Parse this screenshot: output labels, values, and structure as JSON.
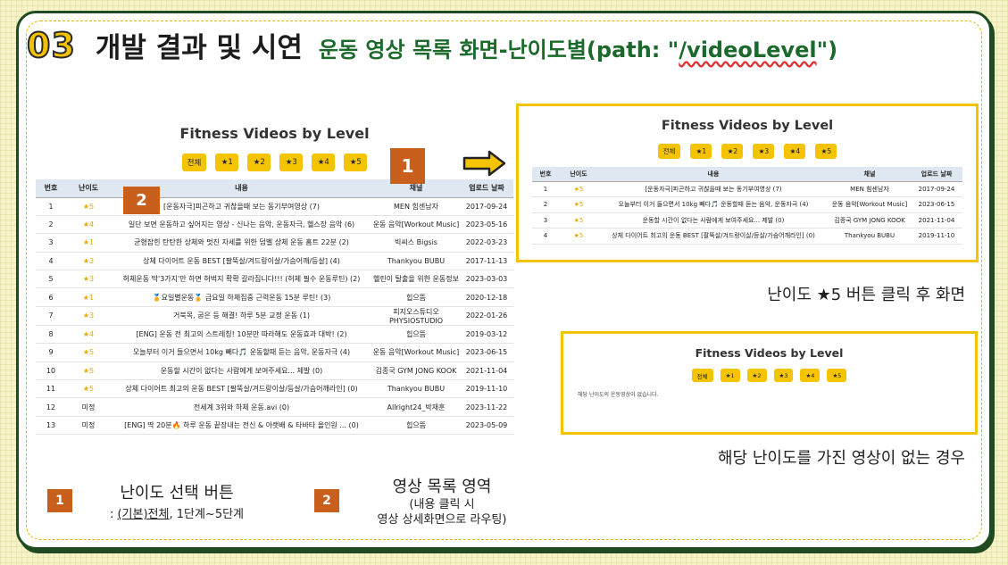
{
  "header": {
    "number": "03",
    "title": "개발 결과 및 시연",
    "subtitle_prefix": "운동 영상 목록 화면-난이도별(path: \"",
    "subtitle_path": "/videoLevel",
    "subtitle_suffix": "\")"
  },
  "main": {
    "title": "Fitness Videos by Level",
    "level_buttons": [
      "전체",
      "★1",
      "★2",
      "★3",
      "★4",
      "★5"
    ],
    "columns": [
      "번호",
      "난이도",
      "내용",
      "채널",
      "업로드 날짜"
    ],
    "rows": [
      {
        "no": "1",
        "level": "★5",
        "title": "[운동자극]피곤하고 귀찮을때 보는 동기부여영상 (7)",
        "channel": "MEN 힘센남자",
        "date": "2017-09-24"
      },
      {
        "no": "2",
        "level": "★4",
        "title": "일단 보면 운동하고 싶어지는 영상 - 신나는 음악, 운동자극, 헬스장 음악 (6)",
        "channel": "운동 음악[Workout Music]",
        "date": "2023-05-16"
      },
      {
        "no": "3",
        "level": "★1",
        "title": "균형잡힌 탄탄한 상체와 멋진 자세를 위한 덤벨 상체 운동 홈트 22분 (2)",
        "channel": "빅씨스 Bigsis",
        "date": "2022-03-23"
      },
      {
        "no": "4",
        "level": "★3",
        "title": "상체 다이어트 운동 BEST [팔뚝살/겨드랑이살/가슴어깨/등살] (4)",
        "channel": "Thankyou BUBU",
        "date": "2017-11-13"
      },
      {
        "no": "5",
        "level": "★3",
        "title": "허체운동 딱'3가지'만 하면 허벅지 확확 갈라집니다!!! (허체 필수 운동루틴) (2)",
        "channel": "헬린이 탈출을 위한 운동정보",
        "date": "2023-03-03"
      },
      {
        "no": "6",
        "level": "★1",
        "title": "🏅요일별운동🏅 금요일 하체집중 근력운동 15분 루틴! (3)",
        "channel": "힙으뜸",
        "date": "2020-12-18"
      },
      {
        "no": "7",
        "level": "★3",
        "title": "거북목, 굽은 등 해결! 하루 5분 교정 운동 (1)",
        "channel": "피지오스튜디오 PHYSIOSTUDIO",
        "date": "2022-01-26"
      },
      {
        "no": "8",
        "level": "★4",
        "title": "[ENG] 운동 전 최고의 스트레칭! 10분만 따라해도 운동효과 대박! (2)",
        "channel": "힙으뜸",
        "date": "2019-03-12"
      },
      {
        "no": "9",
        "level": "★5",
        "title": "오늘부터 이거 들으면서 10kg 빼다🎵 운동할때 듣는 음악, 운동자극 (4)",
        "channel": "운동 음악[Workout Music]",
        "date": "2023-06-15"
      },
      {
        "no": "10",
        "level": "★5",
        "title": "운동할 시간이 없다는 사람에게 보여주세요... 제발 (0)",
        "channel": "김종국 GYM JONG KOOK",
        "date": "2021-11-04"
      },
      {
        "no": "11",
        "level": "★5",
        "title": "상체 다이어트 최고의 운동 BEST [팔뚝살/겨드랑이살/등살/가슴어깨라인] (0)",
        "channel": "Thankyou BUBU",
        "date": "2019-11-10"
      },
      {
        "no": "12",
        "level": "미정",
        "title": "전세계 3위와 하체 운동.avi (0)",
        "channel": "Allright24_박재훈",
        "date": "2023-11-22"
      },
      {
        "no": "13",
        "level": "미정",
        "title": "[ENG] 딱 20분🔥 하루 운동 끝장내는 전신 & 아랫배 & 타바타 올인원 ... (0)",
        "channel": "힙으뜸",
        "date": "2023-05-09"
      }
    ]
  },
  "badges": {
    "one": "1",
    "two": "2"
  },
  "panel_level5": {
    "title": "Fitness Videos by Level",
    "level_buttons": [
      "전체",
      "★1",
      "★2",
      "★3",
      "★4",
      "★5"
    ],
    "columns": [
      "번호",
      "난이도",
      "내용",
      "채널",
      "업로드 날짜"
    ],
    "rows": [
      {
        "no": "1",
        "level": "★5",
        "title": "[운동자극]피곤하고 귀찮을때 보는 동기부여영상 (7)",
        "channel": "MEN 힘센남자",
        "date": "2017-09-24"
      },
      {
        "no": "2",
        "level": "★5",
        "title": "오늘부터 이거 들으면서 10kg 빼다🎵 운동할때 듣는 음악, 운동자극 (4)",
        "channel": "운동 음악[Workout Music]",
        "date": "2023-06-15"
      },
      {
        "no": "3",
        "level": "★5",
        "title": "운동할 시간이 없다는 사람에게 보여주세요... 제발 (0)",
        "channel": "김종국 GYM JONG KOOK",
        "date": "2021-11-04"
      },
      {
        "no": "4",
        "level": "★5",
        "title": "상체 다이어트 최고의 운동 BEST [팔뚝살/겨드랑이살/등살/가슴어깨라인] (0)",
        "channel": "Thankyou BUBU",
        "date": "2019-11-10"
      }
    ],
    "caption": "난이도 ★5 버튼 클릭 후 화면"
  },
  "panel_empty": {
    "title": "Fitness Videos by Level",
    "level_buttons": [
      "전체",
      "★1",
      "★2",
      "★3",
      "★4",
      "★5"
    ],
    "message": "해당 난이도의 운동영상이 없습니다.",
    "caption": "해당 난이도를 가진 영상이 없는 경우"
  },
  "legend": {
    "item1": {
      "number": "1",
      "main": "난이도 선택 버튼",
      "sub_prefix": ": ",
      "sub_underlined": "(기본)전체",
      "sub_suffix": ", 1단계~5단계"
    },
    "item2": {
      "number": "2",
      "main": "영상 목록 영역",
      "sub_line1": "(내용 클릭 시",
      "sub_line2": "영상 상세화면으로 라우팅)"
    }
  },
  "colors": {
    "accent_yellow": "#f5c400",
    "badge_orange": "#c95f1c",
    "frame_green": "#1f4a22",
    "subtitle_green": "#1b6a2c"
  }
}
